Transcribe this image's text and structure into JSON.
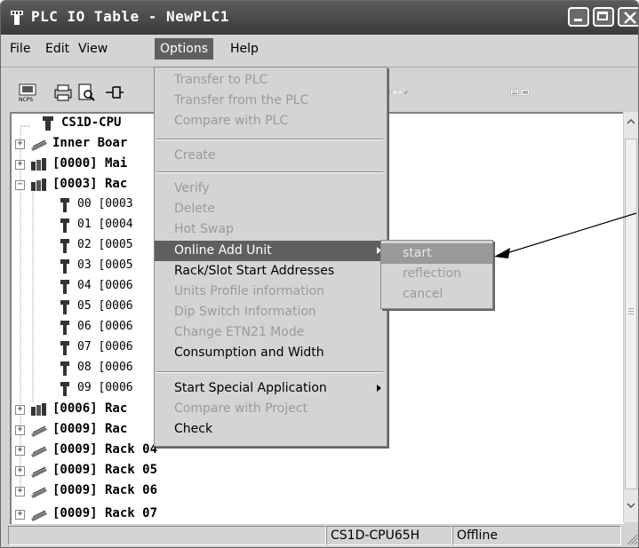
{
  "window": {
    "title": "PLC IO Table - NewPLC1"
  },
  "menubar": {
    "file": "File",
    "edit": "Edit",
    "view": "View",
    "options": "Options",
    "help": "Help"
  },
  "tree": {
    "root": "CS1D-CPU",
    "inner_board": "Inner Boar",
    "rack_0000": "[0000] Mai",
    "rack_0003": "[0003] Rac",
    "slots": [
      "00 [0003",
      "01 [0004",
      "02 [0005",
      "03 [0005",
      "04 [0006",
      "05 [0006",
      "06 [0006",
      "07 [0006",
      "08 [0006",
      "09 [0006"
    ],
    "rack_0006": "[0006] Rac",
    "rack_0009a": "[0009] Rac",
    "rack_04": "[0009] Rack 04",
    "rack_05": "[0009] Rack 05",
    "rack_06": "[0009] Rack 06",
    "rack_07": "[0009] Rack 07"
  },
  "options_menu": {
    "transfer_to": "Transfer to PLC",
    "transfer_from": "Transfer from the PLC",
    "compare_plc": "Compare with PLC",
    "create": "Create",
    "verify": "Verify",
    "delete": "Delete",
    "hot_swap": "Hot Swap",
    "online_add": "Online Add Unit",
    "rack_slot": "Rack/Slot Start Addresses",
    "units_profile": "Units Profile information",
    "dip_switch": "Dip Switch Information",
    "change_etn": "Change ETN21 Mode",
    "consumption": "Consumption and Width",
    "start_special": "Start Special Application",
    "compare_project": "Compare with Project",
    "check": "Check"
  },
  "submenu": {
    "start": "start",
    "reflection": "reflection",
    "cancel": "cancel"
  },
  "status": {
    "model": "CS1D-CPU65H",
    "mode": "Offline"
  }
}
